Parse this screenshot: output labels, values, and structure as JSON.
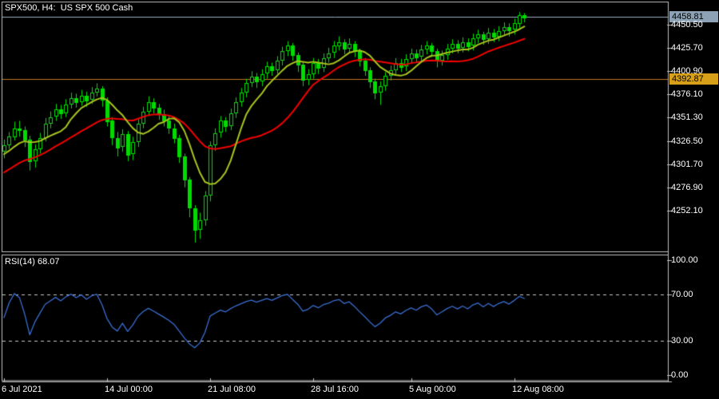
{
  "window": {
    "title": "SPX500, H4:  US SPX 500 Cash",
    "background": "#000000"
  },
  "colors": {
    "candle": "#00DC00",
    "ma_fast": "#A8C41E",
    "ma_slow": "#F20000",
    "current_price_line": "#9DAFC2",
    "current_price_badge_bg": "#8DA2B5",
    "hline": "#C07820",
    "hline_badge_bg": "#D8A018",
    "rsi_line": "#3A6ED2",
    "rsi_levels": "#C8C8C8",
    "axis_text": "#FFFFFF",
    "frame": "#C0C0C0"
  },
  "main_panel": {
    "current_price_badge": "4458.81",
    "hline_badge": "4392.87",
    "price_axis_labels": [
      "4450.50",
      "4425.70",
      "4400.90",
      "4376.10",
      "4351.30",
      "4326.50",
      "4301.70",
      "4276.90",
      "4252.10"
    ]
  },
  "rsi_panel": {
    "label": "RSI(14) 68.07",
    "scale_labels": [
      "100.00",
      "70.00",
      "30.00",
      "0.00"
    ],
    "scale_values": [
      100,
      70,
      30,
      0
    ]
  },
  "time_axis": {
    "labels": [
      {
        "text": "6 Jul 2021",
        "bar": 0
      },
      {
        "text": "14 Jul 00:00",
        "bar": 20
      },
      {
        "text": "21 Jul 08:00",
        "bar": 40
      },
      {
        "text": "28 Jul 16:00",
        "bar": 60
      },
      {
        "text": "5 Aug 00:00",
        "bar": 79
      },
      {
        "text": "12 Aug 08:00",
        "bar": 99
      }
    ]
  },
  "chart_data": {
    "type": "candlestick",
    "title": "SPX500, H4: US SPX 500 Cash",
    "symbol": "SPX500",
    "timeframe": "H4",
    "price_axis": {
      "tick_values": [
        4450.5,
        4425.7,
        4400.9,
        4376.1,
        4351.3,
        4326.5,
        4301.7,
        4276.9,
        4252.1
      ],
      "tick_step": 24.8,
      "visible_range": [
        4218,
        4465
      ]
    },
    "hlines": [
      {
        "price": 4392.87,
        "style": "solid",
        "role": "horizontal-line"
      },
      {
        "price": 4458.81,
        "style": "solid",
        "role": "current-price"
      }
    ],
    "overlays": [
      {
        "name": "ma-fast",
        "type": "sma",
        "period": 8
      },
      {
        "name": "ma-slow",
        "type": "sma",
        "period": 21
      }
    ],
    "rsi": {
      "period": 14,
      "current": 68.07,
      "levels": [
        70,
        30
      ],
      "range": [
        0,
        100
      ]
    },
    "bars": 102,
    "candles_ohlc": [
      [
        4315,
        4328,
        4308,
        4322
      ],
      [
        4322,
        4336,
        4318,
        4331
      ],
      [
        4331,
        4347,
        4327,
        4340
      ],
      [
        4340,
        4348,
        4331,
        4338
      ],
      [
        4338,
        4342,
        4320,
        4328
      ],
      [
        4328,
        4332,
        4295,
        4305
      ],
      [
        4305,
        4323,
        4298,
        4318
      ],
      [
        4318,
        4335,
        4313,
        4330
      ],
      [
        4330,
        4351,
        4326,
        4345
      ],
      [
        4345,
        4358,
        4340,
        4352
      ],
      [
        4352,
        4366,
        4348,
        4360
      ],
      [
        4360,
        4365,
        4350,
        4356
      ],
      [
        4356,
        4371,
        4352,
        4365
      ],
      [
        4365,
        4378,
        4361,
        4372
      ],
      [
        4372,
        4377,
        4362,
        4368
      ],
      [
        4368,
        4381,
        4364,
        4375
      ],
      [
        4375,
        4379,
        4363,
        4370
      ],
      [
        4370,
        4384,
        4366,
        4378
      ],
      [
        4378,
        4388,
        4374,
        4382
      ],
      [
        4382,
        4385,
        4363,
        4370
      ],
      [
        4370,
        4373,
        4342,
        4348
      ],
      [
        4348,
        4352,
        4322,
        4330
      ],
      [
        4330,
        4336,
        4310,
        4320
      ],
      [
        4320,
        4339,
        4315,
        4334
      ],
      [
        4334,
        4337,
        4305,
        4312
      ],
      [
        4312,
        4331,
        4306,
        4325
      ],
      [
        4325,
        4350,
        4320,
        4345
      ],
      [
        4345,
        4363,
        4340,
        4358
      ],
      [
        4358,
        4374,
        4353,
        4368
      ],
      [
        4368,
        4372,
        4356,
        4362
      ],
      [
        4362,
        4366,
        4349,
        4355
      ],
      [
        4355,
        4360,
        4342,
        4348
      ],
      [
        4348,
        4353,
        4334,
        4340
      ],
      [
        4340,
        4345,
        4324,
        4330
      ],
      [
        4330,
        4333,
        4303,
        4310
      ],
      [
        4310,
        4313,
        4277,
        4285
      ],
      [
        4285,
        4288,
        4245,
        4255
      ],
      [
        4255,
        4258,
        4218,
        4232
      ],
      [
        4232,
        4250,
        4222,
        4242
      ],
      [
        4242,
        4273,
        4236,
        4268
      ],
      [
        4268,
        4326,
        4262,
        4322
      ],
      [
        4322,
        4340,
        4316,
        4335
      ],
      [
        4335,
        4353,
        4330,
        4348
      ],
      [
        4348,
        4352,
        4336,
        4342
      ],
      [
        4342,
        4361,
        4338,
        4356
      ],
      [
        4356,
        4373,
        4351,
        4368
      ],
      [
        4368,
        4383,
        4363,
        4378
      ],
      [
        4378,
        4393,
        4373,
        4388
      ],
      [
        4388,
        4401,
        4384,
        4395
      ],
      [
        4395,
        4399,
        4383,
        4390
      ],
      [
        4390,
        4403,
        4385,
        4398
      ],
      [
        4398,
        4411,
        4393,
        4406
      ],
      [
        4406,
        4410,
        4396,
        4402
      ],
      [
        4402,
        4417,
        4398,
        4412
      ],
      [
        4412,
        4427,
        4407,
        4422
      ],
      [
        4422,
        4433,
        4417,
        4428
      ],
      [
        4428,
        4431,
        4412,
        4418
      ],
      [
        4418,
        4421,
        4400,
        4408
      ],
      [
        4408,
        4411,
        4385,
        4392
      ],
      [
        4392,
        4403,
        4386,
        4398
      ],
      [
        4398,
        4415,
        4393,
        4410
      ],
      [
        4410,
        4414,
        4398,
        4405
      ],
      [
        4405,
        4420,
        4400,
        4415
      ],
      [
        4415,
        4426,
        4410,
        4420
      ],
      [
        4420,
        4433,
        4415,
        4428
      ],
      [
        4428,
        4438,
        4423,
        4432
      ],
      [
        4432,
        4435,
        4419,
        4425
      ],
      [
        4425,
        4436,
        4420,
        4430
      ],
      [
        4430,
        4433,
        4416,
        4422
      ],
      [
        4422,
        4425,
        4406,
        4412
      ],
      [
        4412,
        4415,
        4396,
        4402
      ],
      [
        4402,
        4405,
        4383,
        4390
      ],
      [
        4390,
        4393,
        4371,
        4378
      ],
      [
        4378,
        4390,
        4365,
        4385
      ],
      [
        4385,
        4400,
        4380,
        4396
      ],
      [
        4396,
        4407,
        4391,
        4402
      ],
      [
        4402,
        4415,
        4397,
        4410
      ],
      [
        4410,
        4414,
        4400,
        4406
      ],
      [
        4406,
        4419,
        4401,
        4414
      ],
      [
        4414,
        4425,
        4409,
        4420
      ],
      [
        4420,
        4424,
        4410,
        4416
      ],
      [
        4416,
        4429,
        4411,
        4424
      ],
      [
        4424,
        4433,
        4419,
        4428
      ],
      [
        4428,
        4431,
        4416,
        4422
      ],
      [
        4422,
        4425,
        4405,
        4412
      ],
      [
        4412,
        4423,
        4407,
        4418
      ],
      [
        4418,
        4430,
        4413,
        4425
      ],
      [
        4425,
        4435,
        4420,
        4430
      ],
      [
        4430,
        4434,
        4420,
        4426
      ],
      [
        4426,
        4437,
        4421,
        4432
      ],
      [
        4432,
        4436,
        4422,
        4428
      ],
      [
        4428,
        4441,
        4423,
        4436
      ],
      [
        4436,
        4445,
        4431,
        4440
      ],
      [
        4440,
        4443,
        4429,
        4435
      ],
      [
        4435,
        4447,
        4430,
        4442
      ],
      [
        4442,
        4446,
        4432,
        4438
      ],
      [
        4438,
        4449,
        4433,
        4444
      ],
      [
        4444,
        4453,
        4439,
        4448
      ],
      [
        4448,
        4452,
        4438,
        4445
      ],
      [
        4445,
        4457,
        4440,
        4452
      ],
      [
        4452,
        4464,
        4447,
        4461
      ],
      [
        4461,
        4463,
        4453,
        4458.81
      ]
    ]
  }
}
